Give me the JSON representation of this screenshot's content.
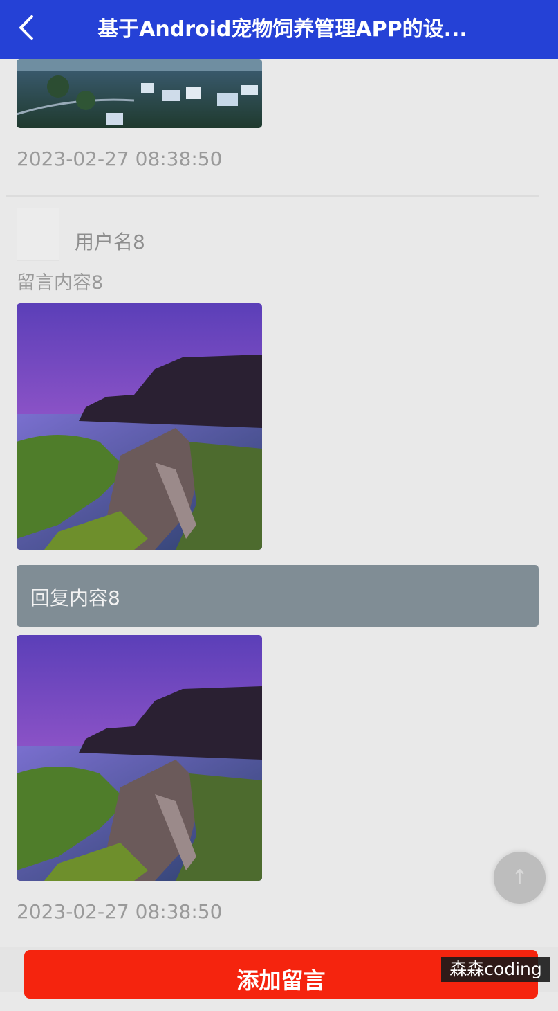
{
  "header": {
    "title": "基于Android宠物饲养管理APP的设..."
  },
  "prev_post": {
    "time": "2023-02-27 08:38:50"
  },
  "post": {
    "username": "用户名8",
    "message": "留言内容8",
    "reply": "回复内容8",
    "time": "2023-02-27 08:38:50"
  },
  "add_button_label": "添加留言",
  "watermark": "森森coding",
  "colors": {
    "header": "#2541d6",
    "add_button": "#f5240e",
    "reply_bg": "#808d95"
  }
}
